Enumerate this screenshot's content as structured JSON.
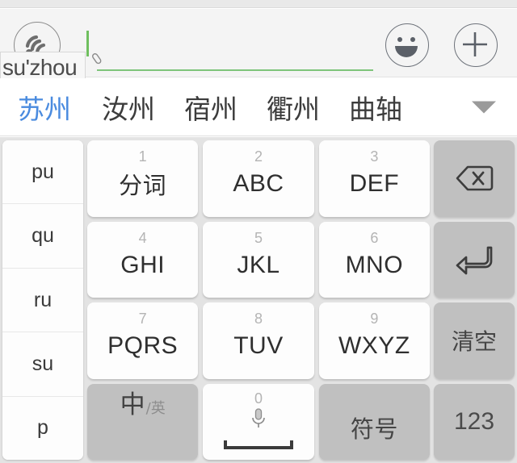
{
  "input_bar": {
    "voice_icon": "voice-wave-icon",
    "composing_text": "su'zhou",
    "edit_icon": "pencil-icon",
    "caret": "text-caret",
    "underline_color": "#7ec47a",
    "emoji_button": "smiley-face-icon",
    "add_button": "plus-icon"
  },
  "candidates": {
    "selected_color": "#4a8bdf",
    "items": [
      {
        "text": "苏州",
        "selected": true
      },
      {
        "text": "汝州",
        "selected": false
      },
      {
        "text": "宿州",
        "selected": false
      },
      {
        "text": "衢州",
        "selected": false
      },
      {
        "text": "曲轴",
        "selected": false
      }
    ],
    "expand_icon": "chevron-down-icon"
  },
  "syllable_column": {
    "items": [
      "pu",
      "qu",
      "ru",
      "su",
      "p"
    ]
  },
  "keypad": {
    "keys": [
      {
        "num": "1",
        "label": "分词",
        "cjk": true,
        "gray": false
      },
      {
        "num": "2",
        "label": "ABC",
        "cjk": false,
        "gray": false
      },
      {
        "num": "3",
        "label": "DEF",
        "cjk": false,
        "gray": false
      },
      {
        "num": "4",
        "label": "GHI",
        "cjk": false,
        "gray": false
      },
      {
        "num": "5",
        "label": "JKL",
        "cjk": false,
        "gray": false
      },
      {
        "num": "6",
        "label": "MNO",
        "cjk": false,
        "gray": false
      },
      {
        "num": "7",
        "label": "PQRS",
        "cjk": false,
        "gray": false
      },
      {
        "num": "8",
        "label": "TUV",
        "cjk": false,
        "gray": false
      },
      {
        "num": "9",
        "label": "WXYZ",
        "cjk": false,
        "gray": false
      }
    ],
    "lang_key": {
      "primary": "中",
      "secondary": "/英"
    },
    "space_key": {
      "num": "0",
      "icon": "microphone-icon"
    },
    "symbol_key": {
      "label": "符号"
    }
  },
  "function_column": {
    "backspace": "backspace-icon",
    "enter": "enter-return-icon",
    "clear_label": "清空",
    "numeric_label": "123"
  },
  "colors": {
    "keyboard_bg": "#e3e3e3",
    "key_bg": "#fdfdfd",
    "func_key_bg": "#c0c0c0",
    "accent_green": "#7ec47a",
    "accent_blue": "#4a8bdf"
  }
}
